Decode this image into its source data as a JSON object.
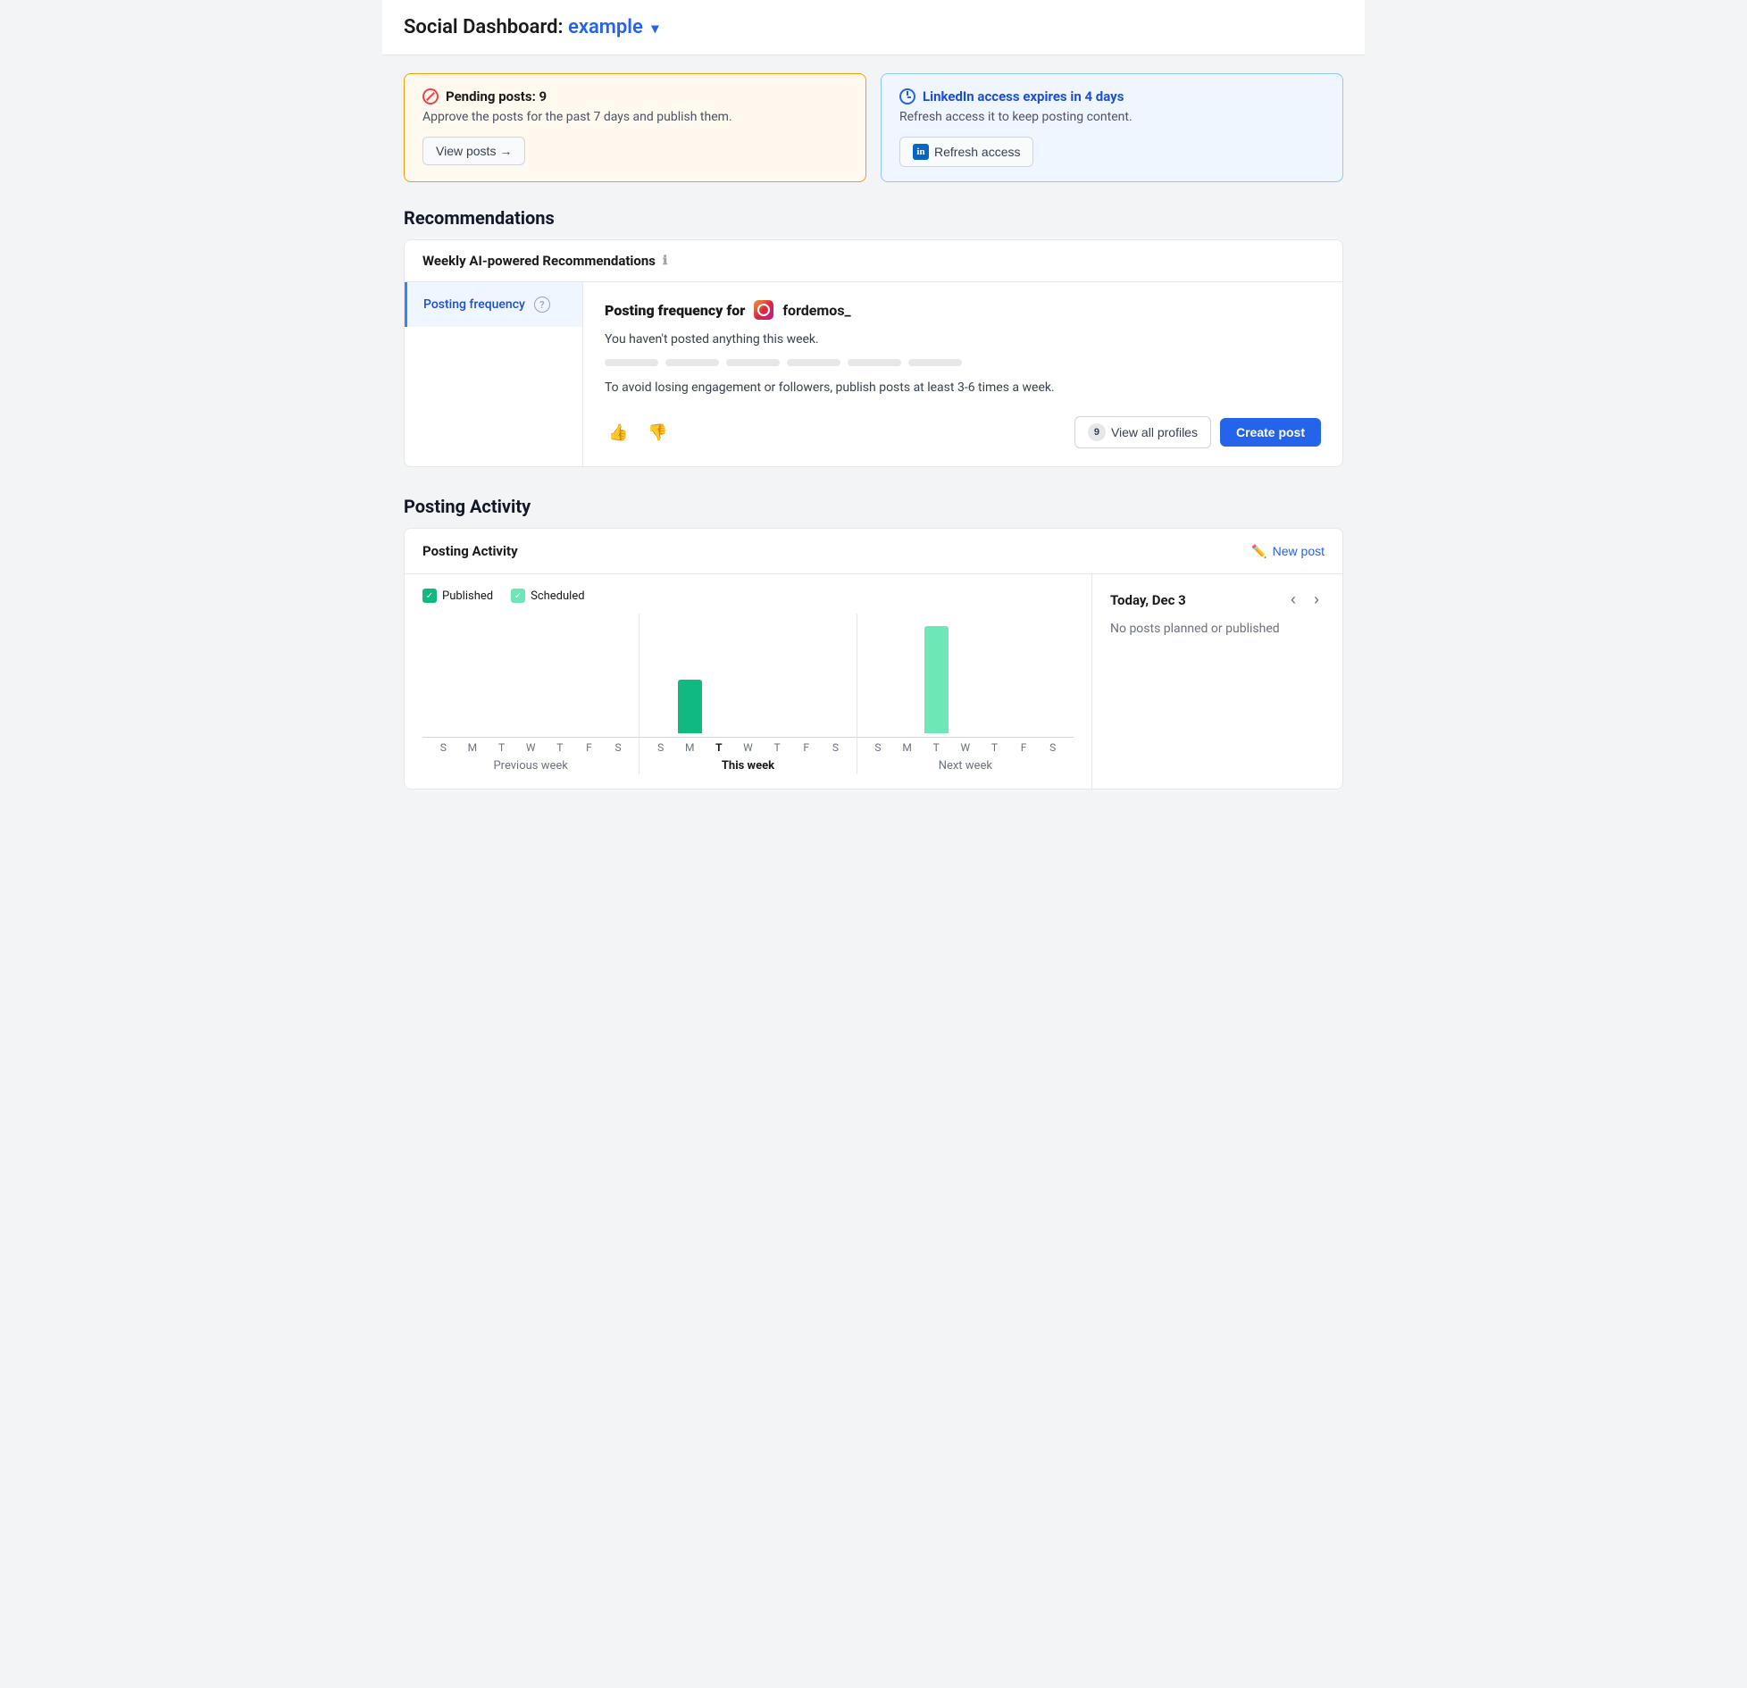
{
  "header": {
    "title_prefix": "Social Dashboard:",
    "title_accent": "example",
    "chevron": "▾"
  },
  "banners": [
    {
      "id": "pending-posts",
      "type": "orange",
      "icon": "circle-slash-icon",
      "title": "Pending posts: 9",
      "desc": "Approve the posts for the past 7 days and publish them.",
      "btn_label": "View posts →"
    },
    {
      "id": "linkedin-access",
      "type": "blue",
      "icon": "clock-icon",
      "title": "LinkedIn access expires in 4 days",
      "desc": "Refresh access it to keep posting content.",
      "btn_label": "Refresh access",
      "btn_icon": "linkedin-icon"
    }
  ],
  "recommendations": {
    "section_title": "Recommendations",
    "card_title": "Weekly AI-powered Recommendations",
    "info_icon": "ℹ",
    "sidebar_items": [
      {
        "label": "Posting frequency",
        "active": true
      }
    ],
    "content": {
      "title_prefix": "Posting frequency for",
      "profile": "fordemos_",
      "no_post_text": "You haven't posted anything this week.",
      "advice": "To avoid losing engagement or followers, publish posts at least 3-6 times a week.",
      "thumbs_up": "👍",
      "thumbs_down": "👎",
      "view_profiles_count": "9",
      "view_profiles_label": "View all profiles",
      "create_post_label": "Create post"
    }
  },
  "posting_activity": {
    "section_title": "Posting Activity",
    "card_title": "Posting Activity",
    "new_post_label": "New post",
    "legend": [
      {
        "label": "Published",
        "color": "green"
      },
      {
        "label": "Scheduled",
        "color": "light"
      }
    ],
    "weeks": [
      {
        "label": "Previous week",
        "bold": false,
        "days": [
          {
            "day": "S",
            "height": 0
          },
          {
            "day": "M",
            "height": 0
          },
          {
            "day": "T",
            "height": 0
          },
          {
            "day": "W",
            "height": 0
          },
          {
            "day": "T",
            "height": 0
          },
          {
            "day": "F",
            "height": 0
          },
          {
            "day": "S",
            "height": 0
          }
        ]
      },
      {
        "label": "This week",
        "bold": true,
        "days": [
          {
            "day": "S",
            "height": 0
          },
          {
            "day": "M",
            "height": 60,
            "active": false
          },
          {
            "day": "T",
            "height": 0,
            "bold": true
          },
          {
            "day": "W",
            "height": 0
          },
          {
            "day": "T",
            "height": 0
          },
          {
            "day": "F",
            "height": 0
          },
          {
            "day": "S",
            "height": 0
          }
        ]
      },
      {
        "label": "Next week",
        "bold": false,
        "days": [
          {
            "day": "S",
            "height": 0
          },
          {
            "day": "M",
            "height": 0
          },
          {
            "day": "T",
            "height": 120,
            "scheduled": true
          },
          {
            "day": "W",
            "height": 0
          },
          {
            "day": "T",
            "height": 0
          },
          {
            "day": "F",
            "height": 0
          },
          {
            "day": "S",
            "height": 0
          }
        ]
      }
    ],
    "sidebar": {
      "date_title": "Today, Dec 3",
      "no_posts_text": "No posts planned or published"
    }
  }
}
